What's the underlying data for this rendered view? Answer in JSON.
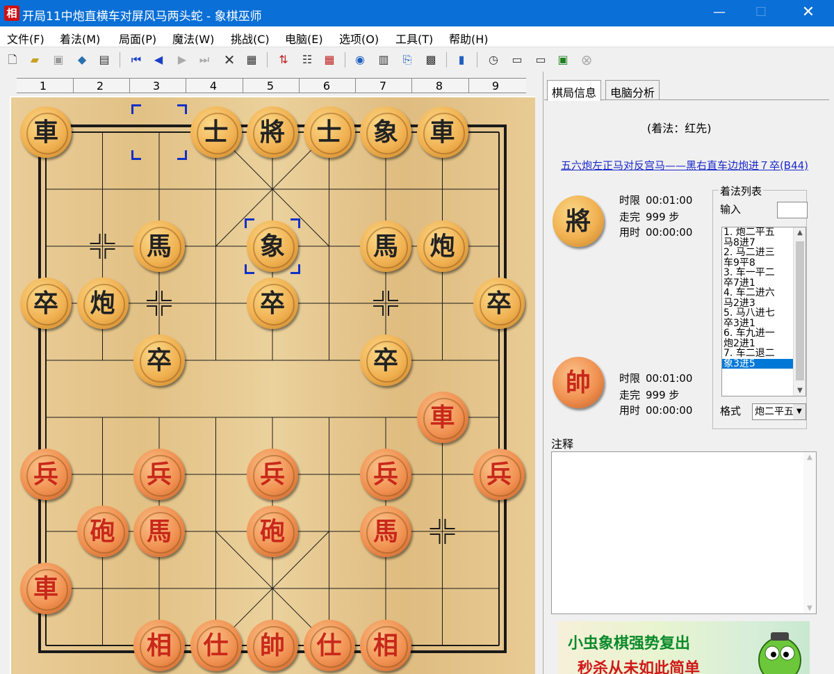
{
  "window": {
    "app_icon": "相",
    "title": "开局11中炮直横车对屏风马两头蛇 - 象棋巫师",
    "minimize_glyph": "—",
    "maximize_glyph": "☐",
    "close_glyph": "✕"
  },
  "menu": [
    "文件(F)",
    "着法(M)",
    "局面(P)",
    "魔法(W)",
    "挑战(C)",
    "电脑(E)",
    "选项(O)",
    "工具(T)",
    "帮助(H)"
  ],
  "toolbar": {
    "icons": [
      "new-file-icon",
      "open-folder-icon",
      "save-icon",
      "book-icon",
      "properties-icon",
      "first-move-icon",
      "prev-move-icon",
      "next-move-icon",
      "last-move-icon",
      "delete-icon",
      "paste-icon",
      "flip-icon",
      "move-tree-icon",
      "board-icon",
      "engine-icon",
      "analysis-icon",
      "export-icon",
      "print-icon",
      "library-icon",
      "clock-icon",
      "computer-red-icon",
      "computer-black-icon",
      "monitor-icon",
      "stop-icon"
    ]
  },
  "ruler": [
    "1",
    "2",
    "3",
    "4",
    "5",
    "6",
    "7",
    "8",
    "9"
  ],
  "board": {
    "pieces": [
      {
        "char": "車",
        "side": "black",
        "file": 0,
        "rank": 0
      },
      {
        "char": "士",
        "side": "black",
        "file": 3,
        "rank": 0
      },
      {
        "char": "將",
        "side": "black",
        "file": 4,
        "rank": 0
      },
      {
        "char": "士",
        "side": "black",
        "file": 5,
        "rank": 0
      },
      {
        "char": "象",
        "side": "black",
        "file": 6,
        "rank": 0
      },
      {
        "char": "車",
        "side": "black",
        "file": 7,
        "rank": 0
      },
      {
        "char": "馬",
        "side": "black",
        "file": 2,
        "rank": 2
      },
      {
        "char": "象",
        "side": "black",
        "file": 4,
        "rank": 2
      },
      {
        "char": "馬",
        "side": "black",
        "file": 6,
        "rank": 2
      },
      {
        "char": "炮",
        "side": "black",
        "file": 7,
        "rank": 2
      },
      {
        "char": "卒",
        "side": "black",
        "file": 0,
        "rank": 3
      },
      {
        "char": "炮",
        "side": "black",
        "file": 1,
        "rank": 3
      },
      {
        "char": "卒",
        "side": "black",
        "file": 4,
        "rank": 3
      },
      {
        "char": "卒",
        "side": "black",
        "file": 8,
        "rank": 3
      },
      {
        "char": "卒",
        "side": "black",
        "file": 2,
        "rank": 4
      },
      {
        "char": "卒",
        "side": "black",
        "file": 6,
        "rank": 4
      },
      {
        "char": "車",
        "side": "red",
        "file": 7,
        "rank": 5
      },
      {
        "char": "兵",
        "side": "red",
        "file": 0,
        "rank": 6
      },
      {
        "char": "兵",
        "side": "red",
        "file": 2,
        "rank": 6
      },
      {
        "char": "兵",
        "side": "red",
        "file": 4,
        "rank": 6
      },
      {
        "char": "兵",
        "side": "red",
        "file": 6,
        "rank": 6
      },
      {
        "char": "兵",
        "side": "red",
        "file": 8,
        "rank": 6
      },
      {
        "char": "砲",
        "side": "red",
        "file": 1,
        "rank": 7
      },
      {
        "char": "馬",
        "side": "red",
        "file": 2,
        "rank": 7
      },
      {
        "char": "砲",
        "side": "red",
        "file": 4,
        "rank": 7
      },
      {
        "char": "馬",
        "side": "red",
        "file": 6,
        "rank": 7
      },
      {
        "char": "車",
        "side": "red",
        "file": 0,
        "rank": 8
      },
      {
        "char": "相",
        "side": "red",
        "file": 2,
        "rank": 9
      },
      {
        "char": "仕",
        "side": "red",
        "file": 3,
        "rank": 9
      },
      {
        "char": "帥",
        "side": "red",
        "file": 4,
        "rank": 9
      },
      {
        "char": "仕",
        "side": "red",
        "file": 5,
        "rank": 9
      },
      {
        "char": "相",
        "side": "red",
        "file": 6,
        "rank": 9
      }
    ],
    "last_move": {
      "from": {
        "file": 2,
        "rank": 0
      },
      "to": {
        "file": 4,
        "rank": 2
      }
    }
  },
  "panel": {
    "tabs": [
      "棋局信息",
      "电脑分析"
    ],
    "move_hint": "(着法：红先)",
    "opening": "五六炮左正马对反宫马——黑右直车边炮进７卒(B44)",
    "black_player": {
      "piece": "將",
      "time_limit_label": "时限",
      "time_limit": "00:01:00",
      "moves_label": "走完",
      "moves": "999 步",
      "used_label": "用时",
      "used": "00:00:00"
    },
    "red_player": {
      "piece": "帥",
      "time_limit_label": "时限",
      "time_limit": "00:01:00",
      "moves_label": "走完",
      "moves": "999 步",
      "used_label": "用时",
      "used": "00:00:00"
    },
    "move_list_title": "着法列表",
    "input_label": "输入",
    "moves": [
      "1. 炮二平五",
      "马8进7",
      "2. 马二进三",
      "车9平8",
      "3. 车一平二",
      "卒7进1",
      "4. 车二进六",
      "马2进3",
      "5. 马八进七",
      "卒3进1",
      "6. 车九进一",
      "炮2进1",
      "7. 车二退二",
      "象3进5"
    ],
    "selected_move_index": 13,
    "format_label": "格式",
    "format_value": "炮二平五",
    "notes_label": "注释",
    "ad_line1": "小虫象棋强势复出",
    "ad_line2": "秒杀从未如此简单"
  }
}
